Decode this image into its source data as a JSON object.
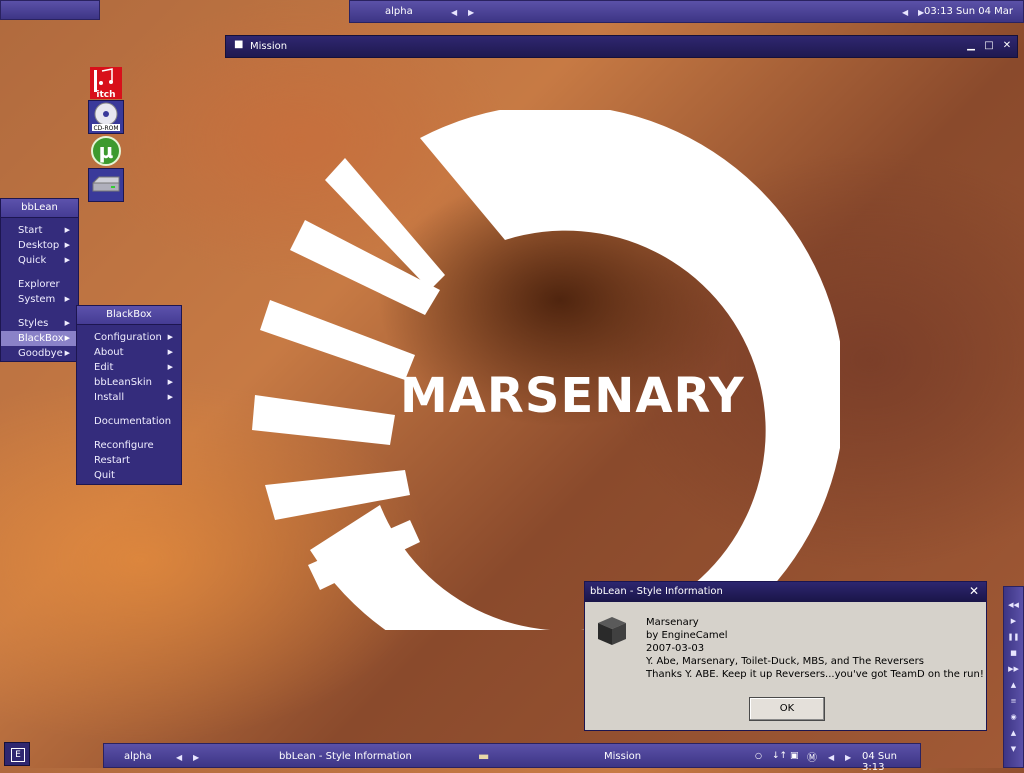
{
  "top_toolbar": {
    "workspace": "alpha",
    "clock": "03:13 Sun 04 Mar"
  },
  "mission_window": {
    "title": "Mission"
  },
  "desktop_icons": [
    {
      "name": "itch",
      "label": "Itch"
    },
    {
      "name": "cdrom",
      "label": "CD-ROM"
    },
    {
      "name": "utorrent",
      "label": "µ"
    },
    {
      "name": "drive",
      "label": ""
    }
  ],
  "wallpaper": {
    "logo_text": "MARSENARY"
  },
  "menu_bblean": {
    "title": "bbLean",
    "items": [
      "Start",
      "Desktop",
      "Quick",
      "Explorer",
      "System",
      "Styles",
      "BlackBox",
      "Goodbye"
    ]
  },
  "menu_blackbox": {
    "title": "BlackBox",
    "items": [
      "Configuration",
      "About",
      "Edit",
      "bbLeanSkin",
      "Install",
      "Documentation",
      "Reconfigure",
      "Restart",
      "Quit"
    ]
  },
  "style_dialog": {
    "title": "bbLean - Style Information",
    "name": "Marsenary",
    "author": "by EngineCamel",
    "date": "2007-03-03",
    "credits": "Y. Abe, Marsenary, Toilet-Duck, MBS, and The Reversers",
    "thanks": "Thanks Y. ABE. Keep it up Reversers...you've got TeamD on the run!",
    "ok_label": "OK"
  },
  "taskbar": {
    "e_label": "E",
    "workspace": "alpha",
    "task1": "bbLean - Style Information",
    "task2": "Mission",
    "clock": "04 Sun 3:13"
  }
}
